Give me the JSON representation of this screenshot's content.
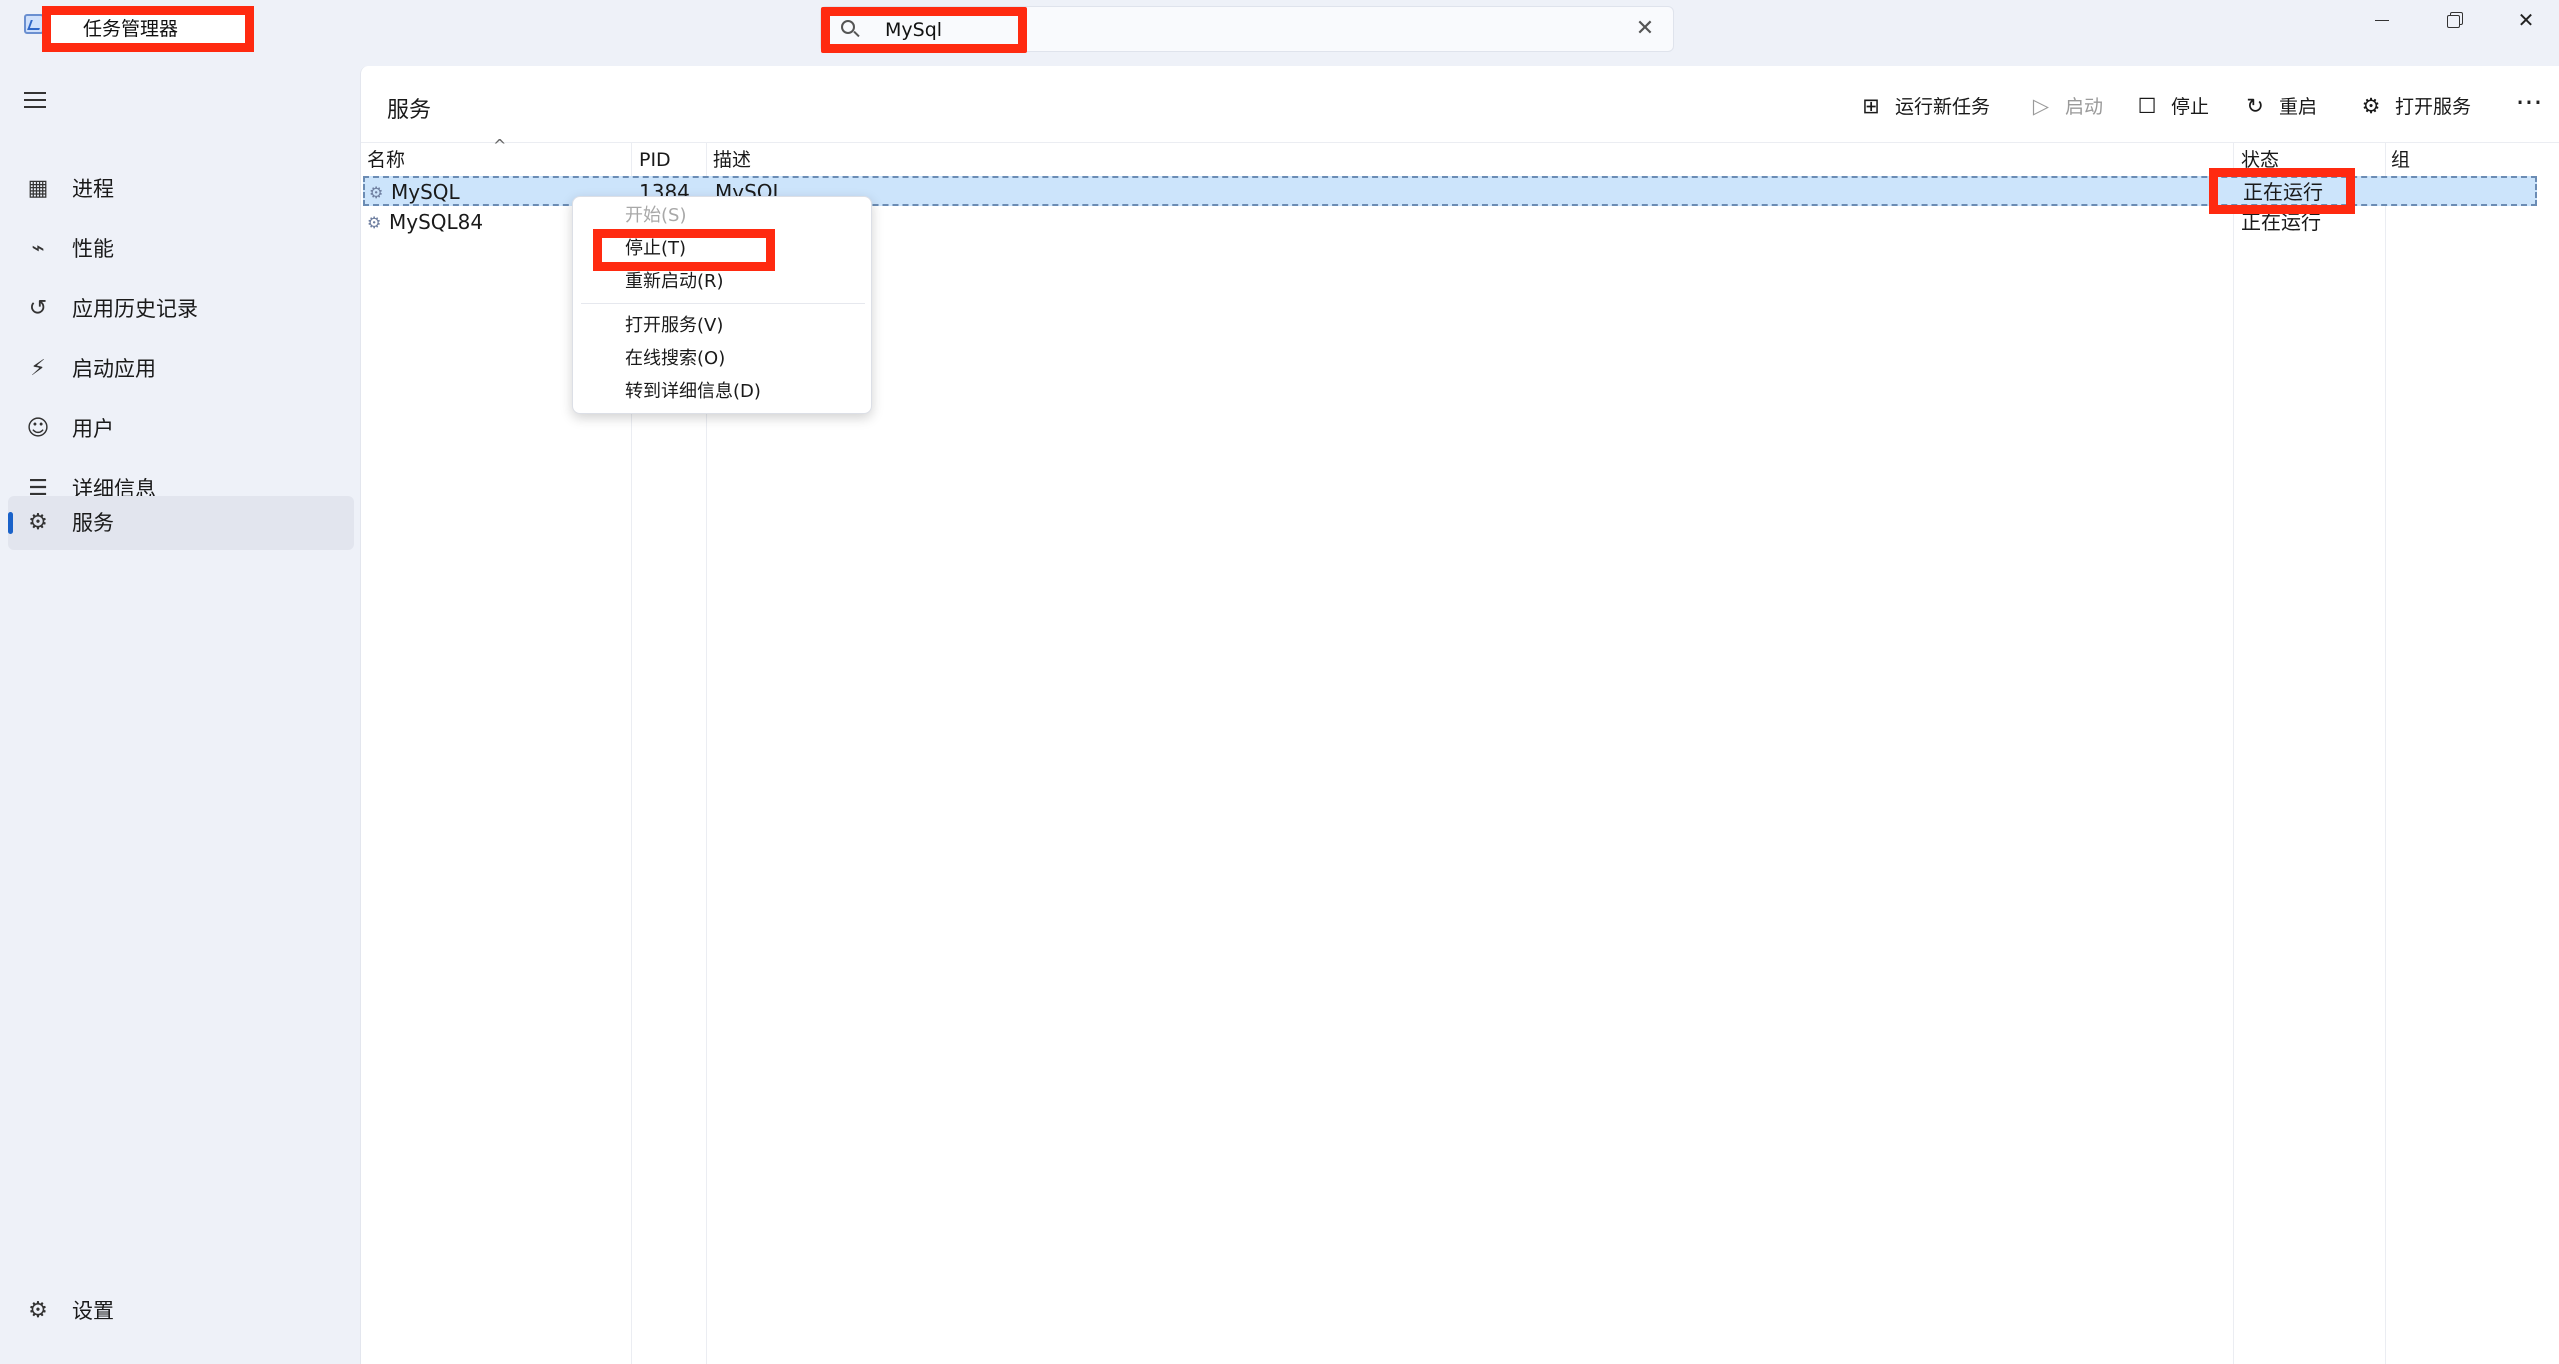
{
  "window": {
    "title": "任务管理器",
    "search_value": "MySql",
    "clear_symbol": "✕"
  },
  "sidebar": {
    "items": [
      {
        "label": "进程",
        "icon": "processes-icon"
      },
      {
        "label": "性能",
        "icon": "performance-icon"
      },
      {
        "label": "应用历史记录",
        "icon": "history-icon"
      },
      {
        "label": "启动应用",
        "icon": "startup-icon"
      },
      {
        "label": "用户",
        "icon": "users-icon"
      },
      {
        "label": "详细信息",
        "icon": "details-icon"
      },
      {
        "label": "服务",
        "icon": "services-icon"
      }
    ],
    "active": "服务",
    "settings_label": "设置"
  },
  "main": {
    "title": "服务",
    "toolbar": {
      "run_task": "运行新任务",
      "start": "启动",
      "stop": "停止",
      "restart": "重启",
      "open_services": "打开服务"
    },
    "columns": {
      "name": "名称",
      "pid": "PID",
      "description": "描述",
      "status": "状态",
      "group": "组"
    },
    "rows": [
      {
        "name": "MySQL",
        "pid": "1384",
        "description": "MySQL",
        "status": "正在运行",
        "group": "",
        "selected": true
      },
      {
        "name": "MySQL84",
        "pid": "",
        "description": "",
        "status": "正在运行",
        "group": "",
        "selected": false
      }
    ]
  },
  "context_menu": {
    "items": [
      {
        "label": "开始(S)",
        "enabled": false
      },
      {
        "label": "停止(T)",
        "enabled": true
      },
      {
        "label": "重新启动(R)",
        "enabled": true
      },
      {
        "label": "打开服务(V)",
        "enabled": true
      },
      {
        "label": "在线搜索(O)",
        "enabled": true
      },
      {
        "label": "转到详细信息(D)",
        "enabled": true
      }
    ]
  },
  "colors": {
    "accent": "#1a62c9",
    "highlight_box": "#ff2a10",
    "selection": "#cce4fb"
  }
}
